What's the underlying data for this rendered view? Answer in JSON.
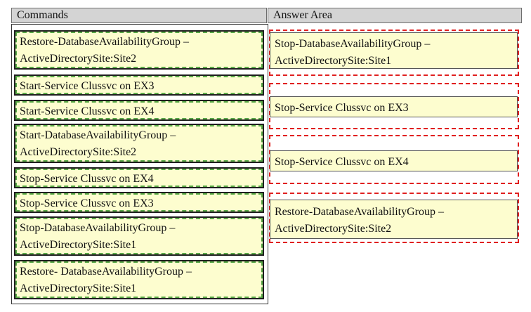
{
  "commands_header": "Commands",
  "answer_header": "Answer Area",
  "commands": [
    {
      "line1": "Restore-DatabaseAvailabilityGroup –",
      "line2": "ActiveDirectorySite:Site2"
    },
    {
      "line1": "Start-Service Clussvc on EX3",
      "line2": ""
    },
    {
      "line1": "Start-Service Clussvc on EX4",
      "line2": ""
    },
    {
      "line1": "Start-DatabaseAvailabilityGroup –",
      "line2": "ActiveDirectorySite:Site2"
    },
    {
      "line1": "Stop-Service Clussvc on EX4",
      "line2": ""
    },
    {
      "line1": "Stop-Service Clussvc on EX3",
      "line2": ""
    },
    {
      "line1": "Stop-DatabaseAvailabilityGroup –",
      "line2": "ActiveDirectorySite:Site1"
    },
    {
      "line1": "Restore- DatabaseAvailabilityGroup –",
      "line2": "ActiveDirectorySite:Site1"
    }
  ],
  "answers": [
    {
      "line1": "Stop-DatabaseAvailabilityGroup –",
      "line2": "ActiveDirectorySite:Site1"
    },
    {
      "line1": "Stop-Service Clussvc on EX3",
      "line2": ""
    },
    {
      "line1": "Stop-Service Clussvc on EX4",
      "line2": ""
    },
    {
      "line1": "Restore-DatabaseAvailabilityGroup –",
      "line2": "ActiveDirectorySite:Site2"
    }
  ]
}
